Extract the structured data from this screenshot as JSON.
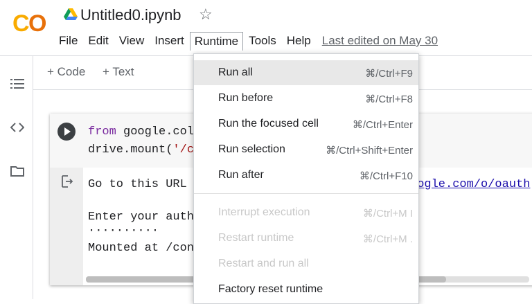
{
  "app": {
    "title": "Untitled0.ipynb",
    "logo_text": "CO",
    "logo_colors": [
      "#f9ab00",
      "#e8710a"
    ]
  },
  "menu": {
    "items": [
      "File",
      "Edit",
      "View",
      "Insert",
      "Runtime",
      "Tools",
      "Help"
    ],
    "active": "Runtime",
    "last_edited": "Last edited on May 30"
  },
  "toolbar": {
    "add_code": "+ Code",
    "add_text": "+ Text"
  },
  "sidebar": {
    "icons": [
      "toc-icon",
      "code-snippets-icon",
      "files-icon"
    ]
  },
  "cell": {
    "code_line1_kw": "from",
    "code_line1_rest": " google.col",
    "code_line2_a": "drive.mount(",
    "code_line2_str": "'/c",
    "output_line1": "Go to this URL",
    "output_line1_link": "oogle.com/o/oauth",
    "output_line2": "Enter your auth",
    "output_line3": "··········",
    "output_line4": "Mounted at /con"
  },
  "runtime_menu": {
    "items": [
      {
        "label": "Run all",
        "shortcut": "⌘/Ctrl+F9",
        "enabled": true,
        "highlighted": true
      },
      {
        "label": "Run before",
        "shortcut": "⌘/Ctrl+F8",
        "enabled": true
      },
      {
        "label": "Run the focused cell",
        "shortcut": "⌘/Ctrl+Enter",
        "enabled": true
      },
      {
        "label": "Run selection",
        "shortcut": "⌘/Ctrl+Shift+Enter",
        "enabled": true
      },
      {
        "label": "Run after",
        "shortcut": "⌘/Ctrl+F10",
        "enabled": true
      },
      {
        "label": "Interrupt execution",
        "shortcut": "⌘/Ctrl+M I",
        "enabled": false
      },
      {
        "label": "Restart runtime",
        "shortcut": "⌘/Ctrl+M .",
        "enabled": false
      },
      {
        "label": "Restart and run all",
        "shortcut": "",
        "enabled": false
      },
      {
        "label": "Factory reset runtime",
        "shortcut": "",
        "enabled": true
      }
    ]
  }
}
